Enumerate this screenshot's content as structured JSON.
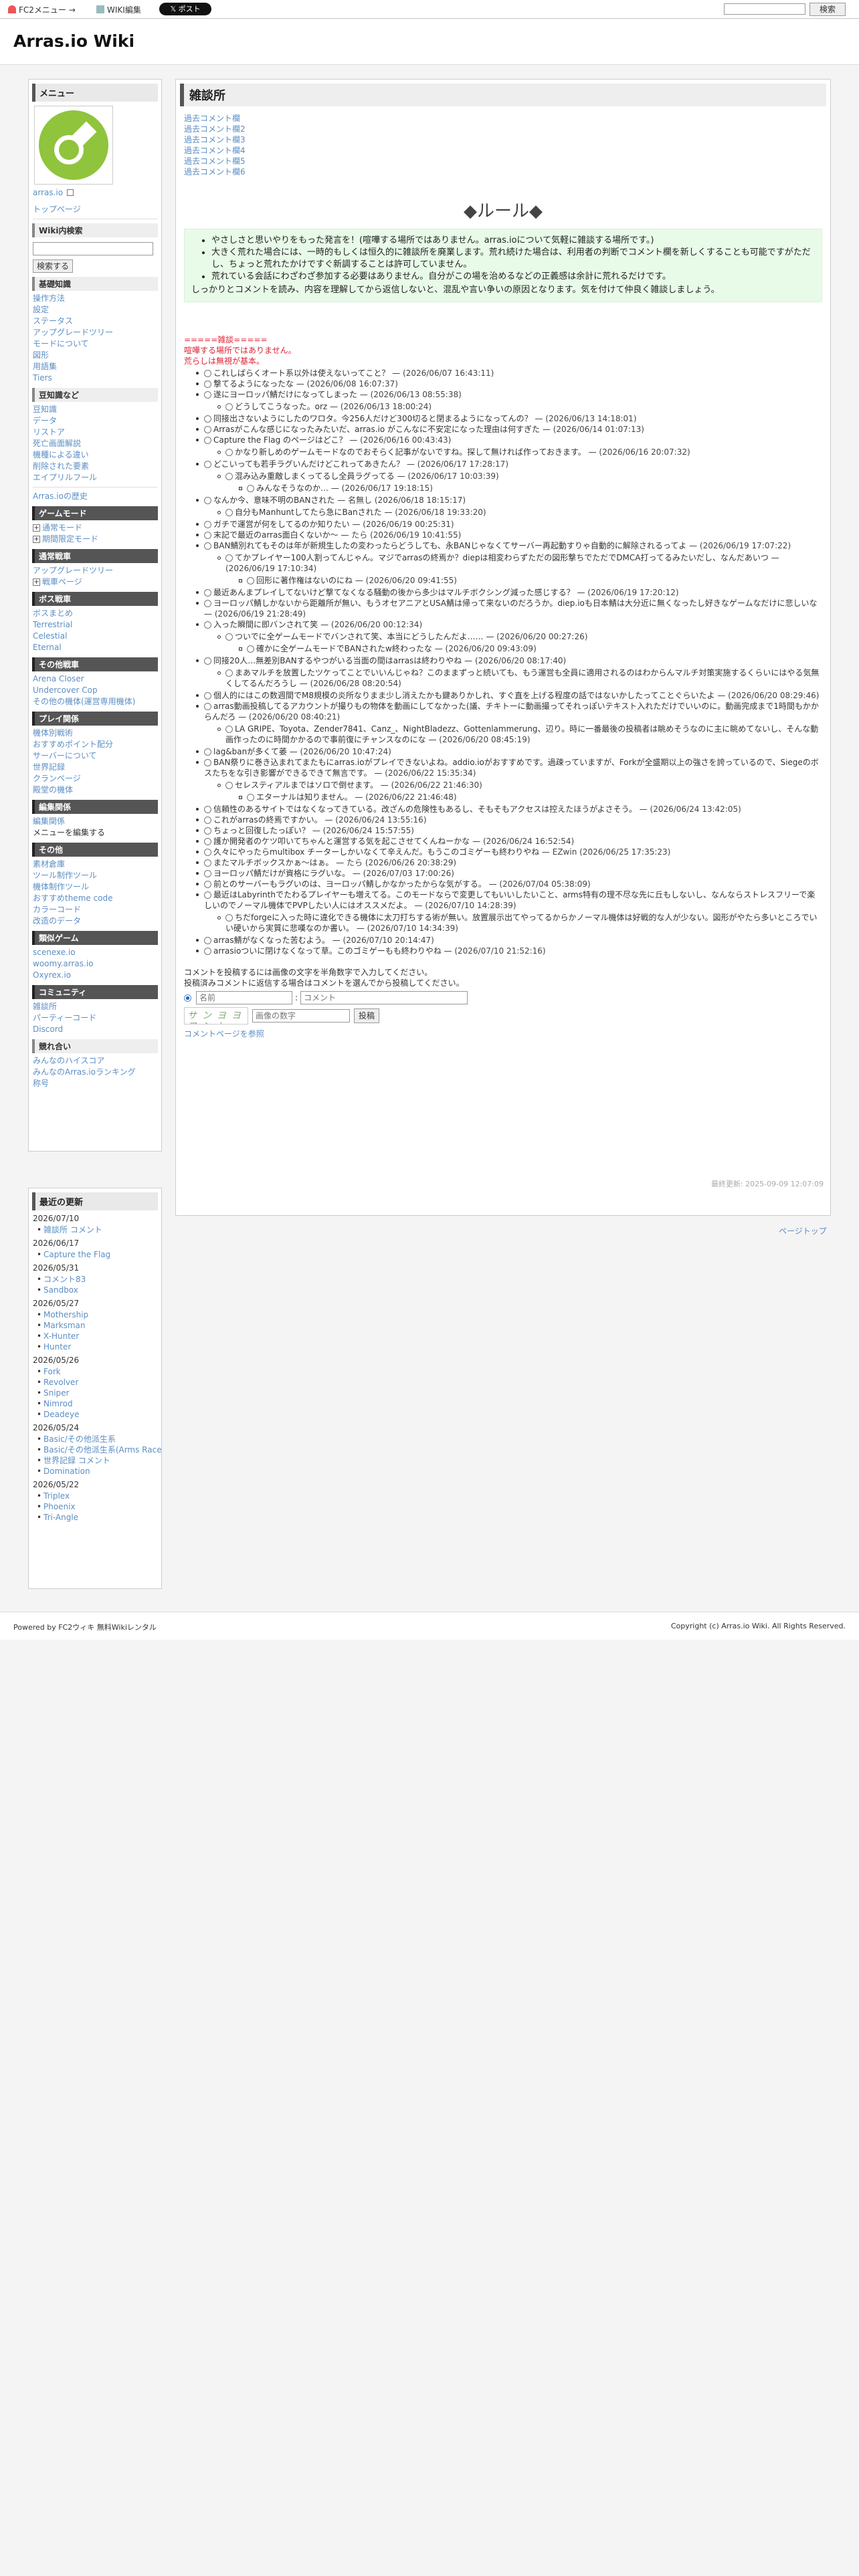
{
  "topbar": {
    "fc2_menu": "FC2メニュー →",
    "wiki_edit": "WIKI編集",
    "post_button": "𝕏 ポスト",
    "search_placeholder": "",
    "search_button": "検索"
  },
  "header": {
    "title": "Arras.io Wiki"
  },
  "sidebar": {
    "menu_label": "メニュー",
    "logo_link": "arras.io",
    "toppage": "トップページ",
    "wiki_search": {
      "heading": "Wiki内検索",
      "button": "検索する"
    },
    "sections": [
      {
        "heading": "基礎知識",
        "items": [
          "操作方法",
          "設定",
          "ステータス",
          "アップグレードツリー",
          "モードについて",
          "図形",
          "用語集",
          "Tiers"
        ]
      },
      {
        "heading": "豆知識など",
        "items": [
          "豆知識",
          "データ",
          "リストア",
          "死亡画面解説",
          "機種による違い",
          "削除された要素",
          "エイプリルフール"
        ]
      }
    ],
    "history_link": "Arras.ioの歴史",
    "game_mode": {
      "heading": "ゲームモード",
      "items": [
        "通常モード",
        "期間限定モード"
      ]
    },
    "normal_tanks": {
      "heading": "通常戦車",
      "items": [
        "アップグレードツリー",
        "戦車ページ"
      ]
    },
    "boss_tanks": {
      "heading": "ボス戦車",
      "items": [
        "ボスまとめ",
        "Terrestrial",
        "Celestial",
        "Eternal"
      ]
    },
    "other_tanks": {
      "heading": "その他戦車",
      "items": [
        "Arena Closer",
        "Undercover Cop",
        "その他の機体(運営専用機体)"
      ]
    },
    "play": {
      "heading": "プレイ関係",
      "items": [
        "機体別戦術",
        "おすすめポイント配分",
        "サーバーについて",
        "世界記録",
        "クランページ",
        "殿堂の機体"
      ]
    },
    "edit": {
      "heading": "編集関係",
      "items": [
        "編集関係",
        "メニューを編集する"
      ]
    },
    "others": {
      "heading": "その他",
      "items": [
        "素材倉庫",
        "ツール制作ツール",
        "機体制作ツール",
        "おすすめtheme code",
        "カラーコード",
        "改造のデータ"
      ]
    },
    "similar": {
      "heading": "類似ゲーム",
      "items": [
        "scenexe.io",
        "woomy.arras.io",
        "Oxyrex.io"
      ]
    },
    "community": {
      "heading": "コミュニティ",
      "items": [
        "雑談所",
        "パーティーコード",
        "Discord"
      ]
    },
    "friends": {
      "heading": "競れ合い",
      "items": [
        "みんなのハイスコア",
        "みんなのArras.ioランキング",
        "称号"
      ]
    }
  },
  "recent": {
    "heading": "最近の更新",
    "days": [
      {
        "date": "2026/07/10",
        "items": [
          "雑談所 コメント"
        ]
      },
      {
        "date": "2026/06/17",
        "items": [
          "Capture the Flag"
        ]
      },
      {
        "date": "2026/05/31",
        "items": [
          "コメント83",
          "Sandbox"
        ]
      },
      {
        "date": "2026/05/27",
        "items": [
          "Mothership",
          "Marksman",
          "X-Hunter",
          "Hunter"
        ]
      },
      {
        "date": "2026/05/26",
        "items": [
          "Fork",
          "Revolver",
          "Sniper",
          "Nimrod",
          "Deadeye"
        ]
      },
      {
        "date": "2026/05/24",
        "items": [
          "Basic/その他派生系",
          "Basic/その他派生系(Arms Race)",
          "世界記録 コメント",
          "Domination"
        ]
      },
      {
        "date": "2026/05/22",
        "items": [
          "Triplex",
          "Phoenix",
          "Tri-Angle"
        ]
      }
    ]
  },
  "main": {
    "title": "雑談所",
    "past_links": [
      "過去コメント欄",
      "過去コメント欄2",
      "過去コメント欄3",
      "過去コメント欄4",
      "過去コメント欄5",
      "過去コメント欄6"
    ],
    "rule_title": "◆ルール◆",
    "rules": [
      "やさしさと思いやりをもった発言を！(喧嘩する場所ではありません。arras.ioについて気軽に雑談する場所です。)",
      "大きく荒れた場合には、一時的もしくは恒久的に雑談所を廃業します。荒れ続けた場合は、利用者の判断でコメント欄を新しくすることも可能ですがただし、ちょっと荒れたかけですぐ新調することは許可していません。",
      "荒れている会話にわざわざ参加する必要はありません。自分がこの場を治めるなどの正義感は余計に荒れるだけです。"
    ],
    "rule_last": "しっかりとコメントを読み、内容を理解してから返信しないと、混乱や言い争いの原因となります。気を付けて仲良く雑談しましょう。",
    "board_heading": "=====雑談=====",
    "board_notes": [
      "喧嘩する場所ではありません。",
      "荒らしは無視が基本。"
    ],
    "comments": [
      {
        "text": "これしばらくオート系以外は使えないってこと？",
        "time": "(2026/06/07 16:43:11)"
      },
      {
        "text": "撃てるようになったな",
        "time": "(2026/06/08 16:07:37)"
      },
      {
        "text": "遂にヨーロッパ鯖だけになってしまった",
        "time": "(2026/06/13 08:55:38)",
        "replies": [
          {
            "text": "どうしてこうなった。orz",
            "time": "(2026/06/13 18:00:24)"
          }
        ]
      },
      {
        "text": "同接出さないようにしたのワロタ。今256人だけど300切ると閉まるようになってんの？",
        "time": "(2026/06/13 14:18:01)"
      },
      {
        "text": "Arrasがこんな感じになったみたいだ、arras.io がこんなに不安定になった理由は何すぎた",
        "time": "(2026/06/14 01:07:13)"
      },
      {
        "text": "Capture the Flag のページはどこ？",
        "time": "(2026/06/16 00:43:43)",
        "replies": [
          {
            "text": "かなり新しめのゲームモードなのでおそらく記事がないですね。探して無ければ作っておきます。",
            "time": "(2026/06/16 20:07:32)"
          }
        ]
      },
      {
        "text": "どこいっても若手ラグいんだけどこれってあきたん？",
        "time": "(2026/06/17 17:28:17)",
        "replies": [
          {
            "text": "混み込み重敵しまくってるし全員ラグってる",
            "time": "(2026/06/17 10:03:39)",
            "replies": [
              {
                "text": "みんなそうなのか…",
                "time": "(2026/06/17 19:18:15)"
              }
            ]
          }
        ]
      },
      {
        "text": "なんか今、意味不明のBANされた",
        "time": "名無し (2026/06/18 18:15:17)",
        "replies": [
          {
            "text": "自分もManhuntしてたら急にBanされた",
            "time": "(2026/06/18 19:33:20)"
          }
        ]
      },
      {
        "text": "ガチで運営が何をしてるのか知りたい",
        "time": "(2026/06/19 00:25:31)"
      },
      {
        "text": "末記で最近のarras面白くないか〜",
        "time": "たら (2026/06/19 10:41:55)"
      },
      {
        "text": "BAN鯖別れてもそのは年が新規生したの変わったらどうしても、永BANじゃなくてサーバー再起動すりゃ自動的に解除されるってよ",
        "time": "(2026/06/19 17:07:22)",
        "replies": [
          {
            "text": "てかプレイヤー100人割ってんじゃん。マジでarrasの終焉か？diepは相変わらずただの図形撃ちでただでDMCA打ってるみたいだし、なんだあいつ",
            "time": "(2026/06/19 17:10:34)",
            "replies": [
              {
                "text": "回形に著作権はないのにね",
                "time": "(2026/06/20 09:41:55)"
              }
            ]
          }
        ]
      },
      {
        "text": "最近あんまプレイしてないけど撃てなくなる騒動の後から多少はマルチボクシング減った感じする？",
        "time": "(2026/06/19 17:20:12)"
      },
      {
        "text": "ヨーロッパ鯖しかないから距離所が無い、もうオセアニアとUSA鯖は帰って来ないのだろうか。diep.ioも日本鯖は大分近に無くなったし好きなゲームなだけに悲しいな",
        "time": "(2026/06/19 21:28:49)"
      },
      {
        "text": "入った瞬間に即バンされて笑",
        "time": "(2026/06/20 00:12:34)",
        "replies": [
          {
            "text": "ついでに全ゲームモードでバンされて笑、本当にどうしたんだよ……",
            "time": "(2026/06/20 00:27:26)",
            "replies": [
              {
                "text": "確かに全ゲームモードでBANされたw終わったな",
                "time": "(2026/06/20 09:43:09)"
              }
            ]
          }
        ]
      },
      {
        "text": "同接20人…無差別BANするやつがいる当面の間はarrasは終わりやね",
        "time": "(2026/06/20 08:17:40)",
        "replies": [
          {
            "text": "まあマルチを放置したツケってことでいいんじゃね？このままずっと続いても、もう運営も全員に適用されるのはわからんマルチ対策実施するくらいにはやる気無くしてるんだろうし",
            "time": "(2026/06/28 08:20:54)"
          }
        ]
      },
      {
        "text": "個人的にはこの数週間でM8規模の炎所なりまま少し消えたかも鍵ありかしれ、すぐ直を上げる程度の話ではないかしたってことぐらいたよ",
        "time": "(2026/06/20 08:29:46)"
      },
      {
        "text": "arras動画投稿してるアカウントが撮りもの物体を動画にしてなかった(議、チキトーに動画撮ってそれっぽいテキスト入れただけでいいのに。動画完成まで1時間もかからんだろ",
        "time": "(2026/06/20 08:40:21)",
        "replies": [
          {
            "text": "LA GRIPE、Toyota、Zender7841、Canz_、NightBladezz、Gottenlammerung、辺り。時に一番最後の投稿者は眺めそうなのに主に眺めてないし、そんな動画作ったのに時間かかるので事前復にチャンスなのにな",
            "time": "(2026/06/20 08:45:19)"
          }
        ]
      },
      {
        "text": "lag&banが多くて萎",
        "time": "(2026/06/20 10:47:24)"
      },
      {
        "text": "BAN祭りに巻き込まれてまたもにarras.ioがプレイできないよね。addio.ioがおすすめです。過疎っていますが、Forkが全盛期以上の強さを誇っているので、Siegeのボスたちをな引き影響ができるできて無言です。",
        "time": "(2026/06/22 15:35:34)",
        "replies": [
          {
            "text": "セレスティアルまではソロで倒せます。",
            "time": "(2026/06/22 21:46:30)",
            "replies": [
              {
                "text": "エターナルは知りません。",
                "time": "(2026/06/22 21:46:48)"
              }
            ]
          }
        ]
      },
      {
        "text": "信頼性のあるサイトではなくなってきている。改ざんの危険性もあるし、そもそもアクセスは控えたほうがよさそう。",
        "time": "(2026/06/24 13:42:05)"
      },
      {
        "text": "これがarrasの終焉ですかい。",
        "time": "(2026/06/24 13:55:16)"
      },
      {
        "text": "ちょっと回復したっぽい？",
        "time": "(2026/06/24 15:57:55)"
      },
      {
        "text": "護か開発者のケツ叩いてちゃんと運営する気を起こさせてくんねーかな",
        "time": "(2026/06/24 16:52:54)"
      },
      {
        "text": "久々にやったらmultibox チーターしかいなくて辛えんだ。もうこのゴミゲーも終わりやね",
        "time": "EZwin (2026/06/25 17:35:23)"
      },
      {
        "text": "またマルチボックスかぁ〜はぁ。",
        "time": "たら (2026/06/26 20:38:29)"
      },
      {
        "text": "ヨーロッパ鯖だけが資格にラグいな。",
        "time": "(2026/07/03 17:00:26)"
      },
      {
        "text": "前とのサーバーもラグいのは、ヨーロッパ鯖しかなかったからな気がする。",
        "time": "(2026/07/04 05:38:09)"
      },
      {
        "text": "最近はLabyrinthでたわるプレイヤーも増えてる。このモードならで変更してもいいしたいこと、arms特有の理不尽な先に丘もしないし、なんならストレスフリーで楽しいのでノーマル機体でPVPしたい人にはオススメだよ。",
        "time": "(2026/07/10 14:28:39)",
        "replies": [
          {
            "text": "ちだforgeに入った時に違化できる機体に太刀打ちする術が無い。放置展示出てやってるからかノーマル機体は好戦的な人が少ない。図形がやたら多いところでいい硬いから実質に悲嘆なのか書い。",
            "time": "(2026/07/10 14:34:39)"
          }
        ]
      },
      {
        "text": "arras鯖がなくなった苦むよう。",
        "time": "(2026/07/10 20:14:47)"
      },
      {
        "text": "arrasioついに閉けなくなって草。このゴミゲーもも終わりやね",
        "time": "(2026/07/10 21:52:16)"
      }
    ],
    "form": {
      "note1": "コメントを投稿するには画像の文字を半角数字で入力してください。",
      "note2": "投稿済みコメントに返信する場合はコメントを選んでから投稿してください。",
      "name_placeholder": "名前",
      "comment_placeholder": "コメント",
      "captcha_text": "サンヨヨフンレ",
      "captcha_placeholder": "画像の数字",
      "submit": "投稿",
      "policy_link": "コメントページを参照"
    },
    "last_updated": "最終更新: 2025-09-09 12:07:09"
  },
  "page_top": "ページトップ",
  "footer": {
    "left": "Powered by FC2ウィキ 無料Wikiレンタル",
    "right": "Copyright (c) Arras.io Wiki. All Rights Reserved."
  },
  "colors": {
    "accent": "#5b8ec4",
    "rule_bg": "#e8fae8",
    "logo_green": "#8fc43c",
    "notice_red": "#d23"
  }
}
